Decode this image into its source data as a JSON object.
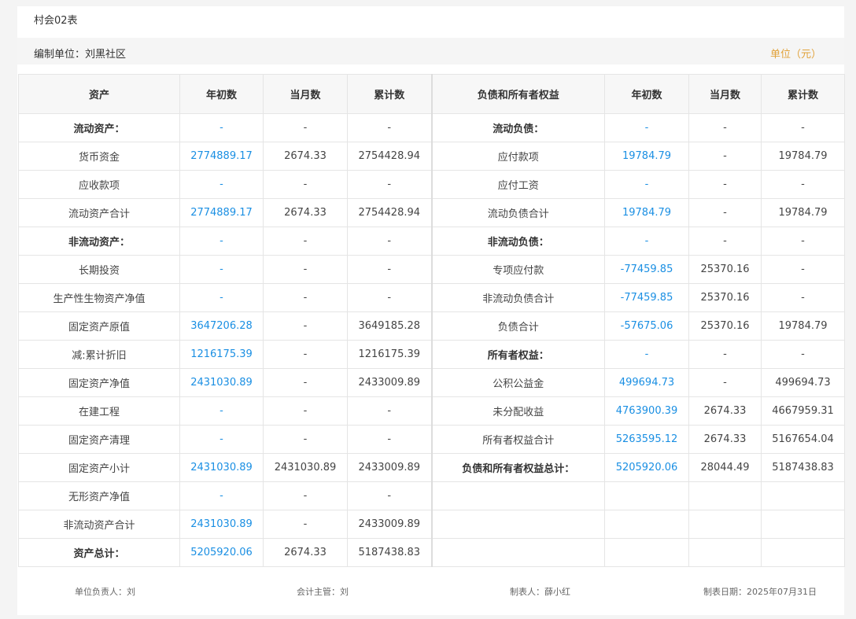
{
  "header": {
    "title": "村会02表"
  },
  "info": {
    "unit_left": "编制单位：刘黑社区",
    "unit_right": "单位（元）"
  },
  "table": {
    "headers": [
      "资产",
      "年初数",
      "当月数",
      "累计数",
      "负债和所有者权益",
      "年初数",
      "当月数",
      "累计数"
    ],
    "rows": [
      [
        {
          "t": "流动资产：",
          "b": true
        },
        {
          "t": "-",
          "blue": true
        },
        {
          "t": "-"
        },
        {
          "t": "-"
        },
        {
          "t": "流动负债：",
          "b": true
        },
        {
          "t": "-",
          "blue": true
        },
        {
          "t": "-"
        },
        {
          "t": "-"
        }
      ],
      [
        {
          "t": "货币资金"
        },
        {
          "t": "2774889.17",
          "blue": true
        },
        {
          "t": "2674.33"
        },
        {
          "t": "2754428.94"
        },
        {
          "t": "应付款项"
        },
        {
          "t": "19784.79",
          "blue": true
        },
        {
          "t": "-"
        },
        {
          "t": "19784.79"
        }
      ],
      [
        {
          "t": "应收款项"
        },
        {
          "t": "-",
          "blue": true
        },
        {
          "t": "-"
        },
        {
          "t": "-"
        },
        {
          "t": "应付工资"
        },
        {
          "t": "-",
          "blue": true
        },
        {
          "t": "-"
        },
        {
          "t": "-"
        }
      ],
      [
        {
          "t": "流动资产合计"
        },
        {
          "t": "2774889.17",
          "blue": true
        },
        {
          "t": "2674.33"
        },
        {
          "t": "2754428.94"
        },
        {
          "t": "流动负债合计"
        },
        {
          "t": "19784.79",
          "blue": true
        },
        {
          "t": "-"
        },
        {
          "t": "19784.79"
        }
      ],
      [
        {
          "t": "非流动资产：",
          "b": true
        },
        {
          "t": "-",
          "blue": true
        },
        {
          "t": "-"
        },
        {
          "t": "-"
        },
        {
          "t": "非流动负债：",
          "b": true
        },
        {
          "t": "-",
          "blue": true
        },
        {
          "t": "-"
        },
        {
          "t": "-"
        }
      ],
      [
        {
          "t": "长期投资"
        },
        {
          "t": "-",
          "blue": true
        },
        {
          "t": "-"
        },
        {
          "t": "-"
        },
        {
          "t": "专项应付款"
        },
        {
          "t": "-77459.85",
          "blue": true
        },
        {
          "t": "25370.16"
        },
        {
          "t": "-"
        }
      ],
      [
        {
          "t": "生产性生物资产净值"
        },
        {
          "t": "-",
          "blue": true
        },
        {
          "t": "-"
        },
        {
          "t": "-"
        },
        {
          "t": "非流动负债合计"
        },
        {
          "t": "-77459.85",
          "blue": true
        },
        {
          "t": "25370.16"
        },
        {
          "t": "-"
        }
      ],
      [
        {
          "t": "固定资产原值"
        },
        {
          "t": "3647206.28",
          "blue": true
        },
        {
          "t": "-"
        },
        {
          "t": "3649185.28"
        },
        {
          "t": "负债合计"
        },
        {
          "t": "-57675.06",
          "blue": true
        },
        {
          "t": "25370.16"
        },
        {
          "t": "19784.79"
        }
      ],
      [
        {
          "t": "减:累计折旧"
        },
        {
          "t": "1216175.39",
          "blue": true
        },
        {
          "t": "-"
        },
        {
          "t": "1216175.39"
        },
        {
          "t": "所有者权益：",
          "b": true
        },
        {
          "t": "-",
          "blue": true
        },
        {
          "t": "-"
        },
        {
          "t": "-"
        }
      ],
      [
        {
          "t": "固定资产净值"
        },
        {
          "t": "2431030.89",
          "blue": true
        },
        {
          "t": "-"
        },
        {
          "t": "2433009.89"
        },
        {
          "t": "公积公益金"
        },
        {
          "t": "499694.73",
          "blue": true
        },
        {
          "t": "-"
        },
        {
          "t": "499694.73"
        }
      ],
      [
        {
          "t": "在建工程"
        },
        {
          "t": "-",
          "blue": true
        },
        {
          "t": "-"
        },
        {
          "t": "-"
        },
        {
          "t": "未分配收益"
        },
        {
          "t": "4763900.39",
          "blue": true
        },
        {
          "t": "2674.33"
        },
        {
          "t": "4667959.31"
        }
      ],
      [
        {
          "t": "固定资产清理"
        },
        {
          "t": "-",
          "blue": true
        },
        {
          "t": "-"
        },
        {
          "t": "-"
        },
        {
          "t": "所有者权益合计"
        },
        {
          "t": "5263595.12",
          "blue": true
        },
        {
          "t": "2674.33"
        },
        {
          "t": "5167654.04"
        }
      ],
      [
        {
          "t": "固定资产小计"
        },
        {
          "t": "2431030.89",
          "blue": true
        },
        {
          "t": "2431030.89"
        },
        {
          "t": "2433009.89"
        },
        {
          "t": "负债和所有者权益总计：",
          "b": true
        },
        {
          "t": "5205920.06",
          "blue": true
        },
        {
          "t": "28044.49"
        },
        {
          "t": "5187438.83"
        }
      ],
      [
        {
          "t": "无形资产净值"
        },
        {
          "t": "-",
          "blue": true
        },
        {
          "t": "-"
        },
        {
          "t": "-"
        },
        {
          "t": ""
        },
        {
          "t": ""
        },
        {
          "t": ""
        },
        {
          "t": ""
        }
      ],
      [
        {
          "t": "非流动资产合计"
        },
        {
          "t": "2431030.89",
          "blue": true
        },
        {
          "t": "-"
        },
        {
          "t": "2433009.89"
        },
        {
          "t": ""
        },
        {
          "t": ""
        },
        {
          "t": ""
        },
        {
          "t": ""
        }
      ],
      [
        {
          "t": "资产总计：",
          "b": true
        },
        {
          "t": "5205920.06",
          "blue": true
        },
        {
          "t": "2674.33"
        },
        {
          "t": "5187438.83"
        },
        {
          "t": ""
        },
        {
          "t": ""
        },
        {
          "t": ""
        },
        {
          "t": ""
        }
      ]
    ]
  },
  "footer": {
    "unit_head": "单位负责人：刘",
    "accountant": "会计主管：刘",
    "preparer": "制表人：薛小红",
    "date": "制表日期：2025年07月31日"
  },
  "colors": {
    "accent": "#1a8fe3",
    "unit": "#e1a23a"
  }
}
